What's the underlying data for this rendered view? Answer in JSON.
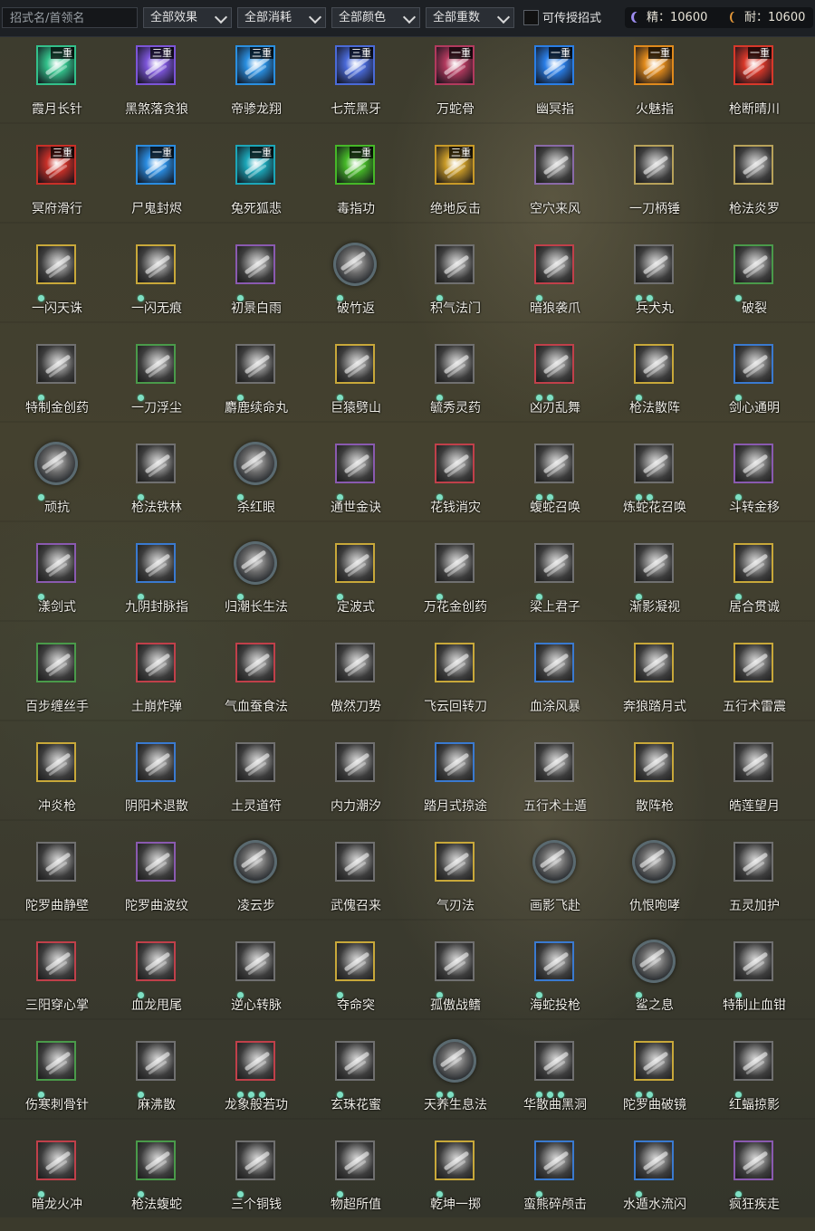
{
  "filters": {
    "search_placeholder": "招式名/首领名",
    "effect": "全部效果",
    "cost": "全部消耗",
    "color": "全部颜色",
    "weight": "全部重数",
    "transferable_label": "可传授招式"
  },
  "resources": {
    "jing": "精：10600",
    "nai": "耐：10600"
  },
  "rows": [
    [
      {
        "name": "霞月长针",
        "badge": "一重",
        "dots": 0,
        "color": "#33c08a"
      },
      {
        "name": "黑煞落贪狼",
        "badge": "三重",
        "dots": 0,
        "color": "#7c55d8"
      },
      {
        "name": "帝骖龙翔",
        "badge": "三重",
        "dots": 0,
        "color": "#2a8fe0"
      },
      {
        "name": "七荒黑牙",
        "badge": "三重",
        "dots": 0,
        "color": "#4a6ad8"
      },
      {
        "name": "万蛇骨",
        "badge": "一重",
        "dots": 0,
        "color": "#b23a5e"
      },
      {
        "name": "幽冥指",
        "badge": "一重",
        "dots": 0,
        "color": "#2a7ee6"
      },
      {
        "name": "火魅指",
        "badge": "一重",
        "dots": 0,
        "color": "#e08a1c"
      },
      {
        "name": "枪断晴川",
        "badge": "一重",
        "dots": 0,
        "color": "#d8382a"
      }
    ],
    [
      {
        "name": "冥府滑行",
        "badge": "三重",
        "dots": 0,
        "color": "#c83028"
      },
      {
        "name": "尸鬼封烬",
        "badge": "一重",
        "dots": 0,
        "color": "#2a8ce0"
      },
      {
        "name": "兔死狐悲",
        "badge": "一重",
        "dots": 0,
        "color": "#1ca6b8"
      },
      {
        "name": "毒指功",
        "badge": "一重",
        "dots": 0,
        "color": "#46b828"
      },
      {
        "name": "绝地反击",
        "badge": "三重",
        "dots": 0,
        "color": "#c89a28"
      },
      {
        "name": "空穴来风",
        "badge": "",
        "dots": 0,
        "color": "#8a6aa8"
      },
      {
        "name": "一刀柄锤",
        "badge": "",
        "dots": 0,
        "color": "#b8a25a"
      },
      {
        "name": "枪法炎罗",
        "badge": "",
        "dots": 0,
        "color": "#b8a25a"
      }
    ],
    [
      {
        "name": "一闪天诛",
        "badge": "",
        "dots": 1,
        "color": "#c8a83a"
      },
      {
        "name": "一闪无痕",
        "badge": "",
        "dots": 1,
        "color": "#c8a83a"
      },
      {
        "name": "初景白雨",
        "badge": "",
        "dots": 1,
        "color": "#8a5ab0"
      },
      {
        "name": "破竹返",
        "badge": "",
        "dots": 1,
        "color": "#5a7080",
        "hex": true
      },
      {
        "name": "积气法门",
        "badge": "",
        "dots": 1,
        "color": "#707070"
      },
      {
        "name": "暗狼袭爪",
        "badge": "",
        "dots": 1,
        "color": "#c0404a"
      },
      {
        "name": "兵犬丸",
        "badge": "",
        "dots": 2,
        "color": "#707070"
      },
      {
        "name": "破裂",
        "badge": "",
        "dots": 1,
        "color": "#4a9a4a"
      }
    ],
    [
      {
        "name": "特制金创药",
        "badge": "",
        "dots": 1,
        "color": "#707070"
      },
      {
        "name": "一刀浮尘",
        "badge": "",
        "dots": 1,
        "color": "#4a9a4a"
      },
      {
        "name": "麝鹿续命丸",
        "badge": "",
        "dots": 1,
        "color": "#707070"
      },
      {
        "name": "巨猿劈山",
        "badge": "",
        "dots": 1,
        "color": "#c8a83a"
      },
      {
        "name": "毓秀灵药",
        "badge": "",
        "dots": 1,
        "color": "#707070"
      },
      {
        "name": "凶刃乱舞",
        "badge": "",
        "dots": 2,
        "color": "#c0404a"
      },
      {
        "name": "枪法散阵",
        "badge": "",
        "dots": 1,
        "color": "#c8a83a"
      },
      {
        "name": "剑心通明",
        "badge": "",
        "dots": 1,
        "color": "#3a7ad0"
      }
    ],
    [
      {
        "name": "顽抗",
        "badge": "",
        "dots": 1,
        "color": "#5a7080",
        "hex": true
      },
      {
        "name": "枪法铁林",
        "badge": "",
        "dots": 1,
        "color": "#707070"
      },
      {
        "name": "杀红眼",
        "badge": "",
        "dots": 1,
        "color": "#5a7080",
        "hex": true
      },
      {
        "name": "通世金诀",
        "badge": "",
        "dots": 1,
        "color": "#8a5ab0"
      },
      {
        "name": "花钱消灾",
        "badge": "",
        "dots": 1,
        "color": "#c0404a"
      },
      {
        "name": "蝮蛇召唤",
        "badge": "",
        "dots": 2,
        "color": "#707070"
      },
      {
        "name": "炼蛇花召唤",
        "badge": "",
        "dots": 2,
        "color": "#707070"
      },
      {
        "name": "斗转金移",
        "badge": "",
        "dots": 1,
        "color": "#8a5ab0"
      }
    ],
    [
      {
        "name": "漾剑式",
        "badge": "",
        "dots": 1,
        "color": "#8a5ab0"
      },
      {
        "name": "九阴封脉指",
        "badge": "",
        "dots": 1,
        "color": "#3a7ad0"
      },
      {
        "name": "归潮长生法",
        "badge": "",
        "dots": 1,
        "color": "#5a7080",
        "hex": true
      },
      {
        "name": "定波式",
        "badge": "",
        "dots": 1,
        "color": "#c8a83a"
      },
      {
        "name": "万花金创药",
        "badge": "",
        "dots": 1,
        "color": "#707070"
      },
      {
        "name": "梁上君子",
        "badge": "",
        "dots": 1,
        "color": "#707070"
      },
      {
        "name": "渐影凝视",
        "badge": "",
        "dots": 1,
        "color": "#707070"
      },
      {
        "name": "居合贯诚",
        "badge": "",
        "dots": 1,
        "color": "#c8a83a"
      }
    ],
    [
      {
        "name": "百步缠丝手",
        "badge": "",
        "dots": 0,
        "color": "#4a9a4a"
      },
      {
        "name": "土崩炸弹",
        "badge": "",
        "dots": 0,
        "color": "#c0404a"
      },
      {
        "name": "气血蚕食法",
        "badge": "",
        "dots": 0,
        "color": "#c0404a"
      },
      {
        "name": "傲然刀势",
        "badge": "",
        "dots": 0,
        "color": "#707070"
      },
      {
        "name": "飞云回转刀",
        "badge": "",
        "dots": 0,
        "color": "#c8a83a"
      },
      {
        "name": "血涂风暴",
        "badge": "",
        "dots": 0,
        "color": "#3a7ad0"
      },
      {
        "name": "奔狼踏月式",
        "badge": "",
        "dots": 0,
        "color": "#c8a83a"
      },
      {
        "name": "五行术雷震",
        "badge": "",
        "dots": 0,
        "color": "#c8a83a"
      }
    ],
    [
      {
        "name": "冲炎枪",
        "badge": "",
        "dots": 0,
        "color": "#c8a83a"
      },
      {
        "name": "阴阳术退散",
        "badge": "",
        "dots": 0,
        "color": "#3a7ad0"
      },
      {
        "name": "土灵道符",
        "badge": "",
        "dots": 0,
        "color": "#707070"
      },
      {
        "name": "内力潮汐",
        "badge": "",
        "dots": 0,
        "color": "#707070"
      },
      {
        "name": "踏月式掠途",
        "badge": "",
        "dots": 0,
        "color": "#3a7ad0"
      },
      {
        "name": "五行术土遁",
        "badge": "",
        "dots": 0,
        "color": "#707070"
      },
      {
        "name": "散阵枪",
        "badge": "",
        "dots": 0,
        "color": "#c8a83a"
      },
      {
        "name": "皓莲望月",
        "badge": "",
        "dots": 0,
        "color": "#707070"
      }
    ],
    [
      {
        "name": "陀罗曲静壁",
        "badge": "",
        "dots": 0,
        "color": "#707070"
      },
      {
        "name": "陀罗曲波纹",
        "badge": "",
        "dots": 0,
        "color": "#8a5ab0"
      },
      {
        "name": "凌云步",
        "badge": "",
        "dots": 0,
        "color": "#5a7080",
        "hex": true
      },
      {
        "name": "武傀召来",
        "badge": "",
        "dots": 0,
        "color": "#707070"
      },
      {
        "name": "气刃法",
        "badge": "",
        "dots": 0,
        "color": "#c8a83a"
      },
      {
        "name": "画影飞赴",
        "badge": "",
        "dots": 0,
        "color": "#5a7080",
        "hex": true
      },
      {
        "name": "仇恨咆哮",
        "badge": "",
        "dots": 0,
        "color": "#5a7080",
        "hex": true
      },
      {
        "name": "五灵加护",
        "badge": "",
        "dots": 0,
        "color": "#707070"
      }
    ],
    [
      {
        "name": "三阳穿心掌",
        "badge": "",
        "dots": 0,
        "color": "#c0404a"
      },
      {
        "name": "血龙甩尾",
        "badge": "",
        "dots": 1,
        "color": "#c0404a"
      },
      {
        "name": "逆心转脉",
        "badge": "",
        "dots": 1,
        "color": "#707070"
      },
      {
        "name": "夺命突",
        "badge": "",
        "dots": 1,
        "color": "#c8a83a"
      },
      {
        "name": "孤傲战鳍",
        "badge": "",
        "dots": 1,
        "color": "#707070"
      },
      {
        "name": "海蛇投枪",
        "badge": "",
        "dots": 1,
        "color": "#3a7ad0"
      },
      {
        "name": "鲨之息",
        "badge": "",
        "dots": 1,
        "color": "#5a7080",
        "hex": true
      },
      {
        "name": "特制止血钳",
        "badge": "",
        "dots": 1,
        "color": "#707070"
      }
    ],
    [
      {
        "name": "伤寒刺骨针",
        "badge": "",
        "dots": 1,
        "color": "#4a9a4a"
      },
      {
        "name": "麻沸散",
        "badge": "",
        "dots": 1,
        "color": "#707070"
      },
      {
        "name": "龙象般若功",
        "badge": "",
        "dots": 3,
        "color": "#c0404a"
      },
      {
        "name": "玄珠花蜜",
        "badge": "",
        "dots": 1,
        "color": "#707070"
      },
      {
        "name": "天养生息法",
        "badge": "",
        "dots": 2,
        "color": "#5a7080",
        "hex": true
      },
      {
        "name": "华散曲黑洞",
        "badge": "",
        "dots": 3,
        "color": "#707070"
      },
      {
        "name": "陀罗曲破镜",
        "badge": "",
        "dots": 2,
        "color": "#c8a83a"
      },
      {
        "name": "红蝠掠影",
        "badge": "",
        "dots": 1,
        "color": "#707070"
      }
    ],
    [
      {
        "name": "暗龙火冲",
        "badge": "",
        "dots": 1,
        "color": "#c0404a"
      },
      {
        "name": "枪法蝮蛇",
        "badge": "",
        "dots": 1,
        "color": "#4a9a4a"
      },
      {
        "name": "三个铜钱",
        "badge": "",
        "dots": 1,
        "color": "#707070"
      },
      {
        "name": "物超所值",
        "badge": "",
        "dots": 1,
        "color": "#707070"
      },
      {
        "name": "乾坤一掷",
        "badge": "",
        "dots": 1,
        "color": "#c8a83a"
      },
      {
        "name": "蛮熊碎颅击",
        "badge": "",
        "dots": 1,
        "color": "#3a7ad0"
      },
      {
        "name": "水遁水流闪",
        "badge": "",
        "dots": 1,
        "color": "#3a7ad0"
      },
      {
        "name": "疯狂疾走",
        "badge": "",
        "dots": 1,
        "color": "#8a5ab0"
      }
    ]
  ]
}
